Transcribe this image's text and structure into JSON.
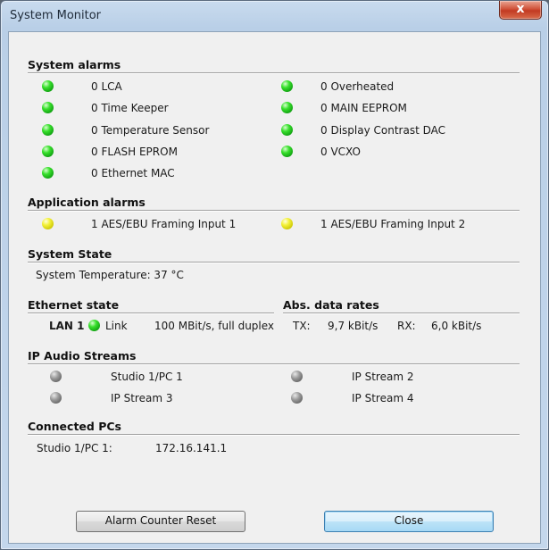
{
  "window": {
    "title": "System Monitor",
    "close_glyph": "x"
  },
  "sections": {
    "system_alarms": "System alarms",
    "application_alarms": "Application alarms",
    "system_state": "System State",
    "ethernet_state": "Ethernet state",
    "abs_data_rates": "Abs. data rates",
    "ip_audio_streams": "IP Audio Streams",
    "connected_pcs": "Connected PCs"
  },
  "system_alarms": [
    {
      "label": "0 LCA",
      "status": "green"
    },
    {
      "label": "0 Overheated",
      "status": "green"
    },
    {
      "label": "0 Time Keeper",
      "status": "green"
    },
    {
      "label": "0 MAIN EEPROM",
      "status": "green"
    },
    {
      "label": "0 Temperature Sensor",
      "status": "green"
    },
    {
      "label": "0 Display Contrast DAC",
      "status": "green"
    },
    {
      "label": "0 FLASH EPROM",
      "status": "green"
    },
    {
      "label": "0 VCXO",
      "status": "green"
    },
    {
      "label": "0 Ethernet MAC",
      "status": "green"
    }
  ],
  "application_alarms": [
    {
      "label": "1 AES/EBU Framing Input 1",
      "status": "yellow"
    },
    {
      "label": "1 AES/EBU Framing Input 2",
      "status": "yellow"
    }
  ],
  "system_state": {
    "temperature": "System Temperature:  37 °C"
  },
  "ethernet": {
    "port": "LAN 1",
    "link": "Link",
    "speed": "100 MBit/s, full duplex",
    "status": "green"
  },
  "data_rates": {
    "tx_label": "TX:",
    "tx_value": "9,7 kBit/s",
    "rx_label": "RX:",
    "rx_value": "6,0 kBit/s"
  },
  "ip_streams": [
    {
      "label": "Studio 1/PC 1",
      "status": "gray"
    },
    {
      "label": "IP Stream 2",
      "status": "gray"
    },
    {
      "label": "IP Stream 3",
      "status": "gray"
    },
    {
      "label": "IP Stream 4",
      "status": "gray"
    }
  ],
  "connected_pcs": [
    {
      "name": "Studio 1/PC 1:",
      "ip": "172.16.141.1"
    }
  ],
  "buttons": {
    "reset": "Alarm Counter Reset",
    "close": "Close"
  },
  "colors": {
    "led_green": "#2ecc2e",
    "led_yellow": "#e8e620",
    "led_gray": "#8a8a8a",
    "default_button": "#bde3f7"
  }
}
